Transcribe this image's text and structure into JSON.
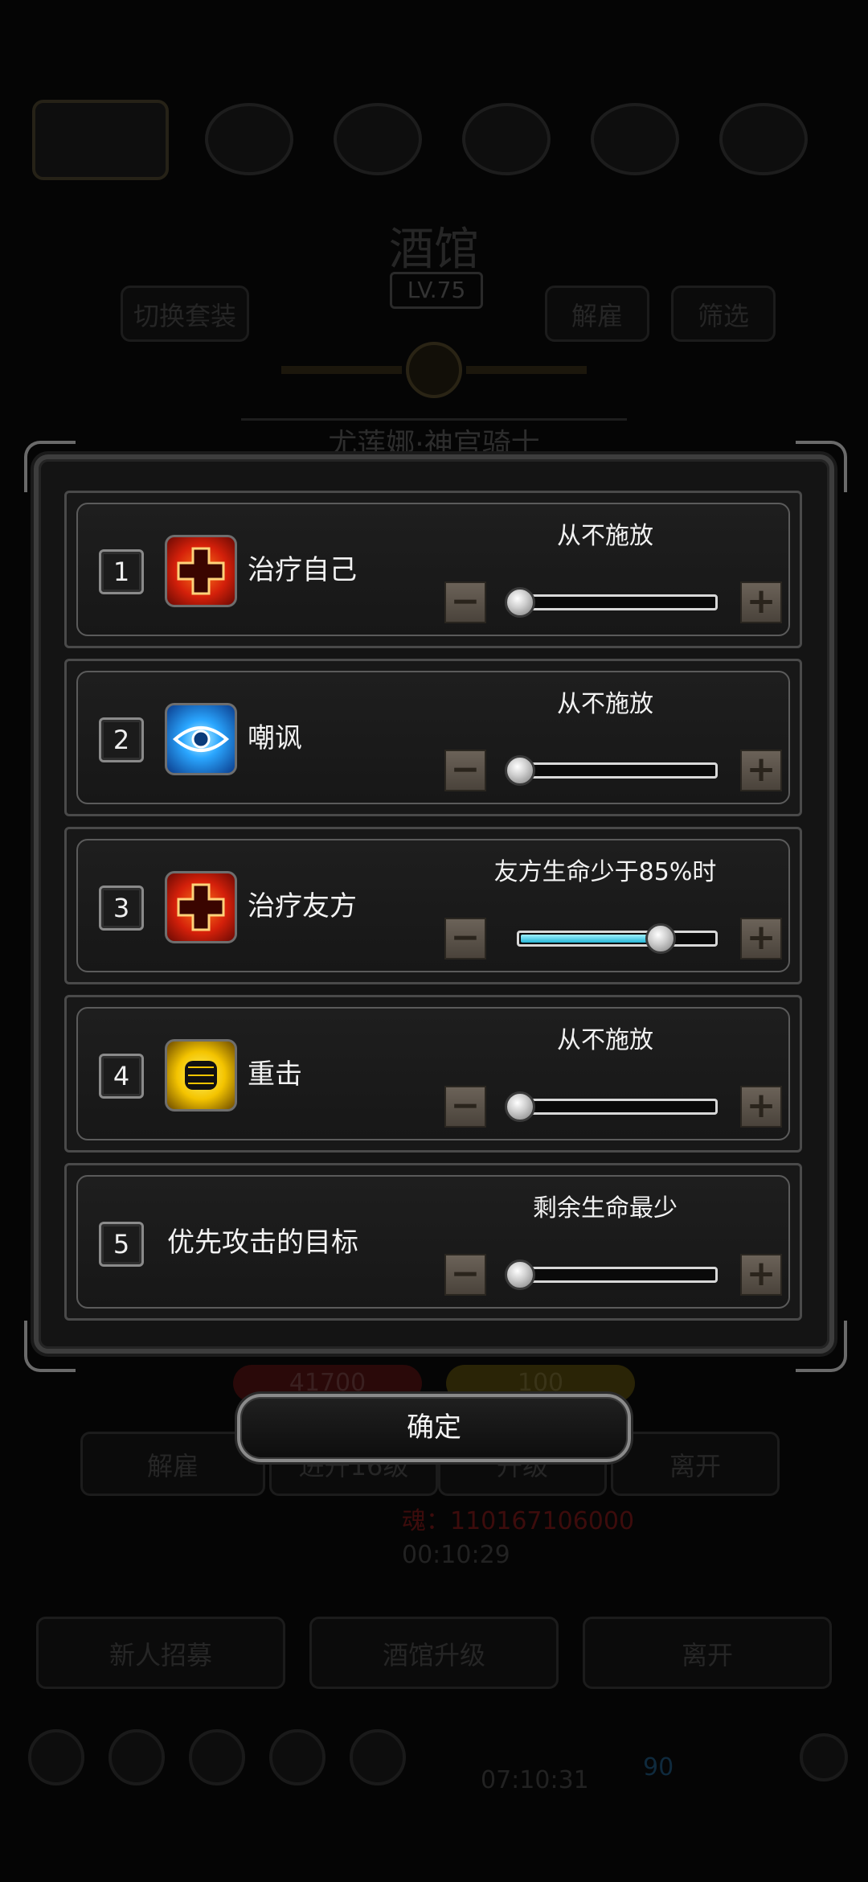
{
  "background": {
    "title": "酒馆",
    "level": "LV.75",
    "switch_equipment": "切换套装",
    "dismiss_top": "解雇",
    "filter": "筛选",
    "hero_name": "尤莲娜·神官骑士",
    "hp_value": "41700",
    "energy_value": "100",
    "btn_dismiss": "解雇",
    "btn_promote": "进升16级",
    "btn_upgrade": "升级",
    "btn_leave": "离开",
    "soul_text": "魂：110167106000",
    "timer": "00:10:29",
    "recruit": "新人招募",
    "tavern_upgrade": "酒馆升级",
    "leave_bottom": "离开",
    "clock": "07:10:31",
    "gem_count": "90"
  },
  "rows": [
    {
      "number": "1",
      "icon": "heal-cross-icon",
      "label": "治疗自己",
      "setting": "从不施放",
      "level": 0.0
    },
    {
      "number": "2",
      "icon": "taunt-eye-icon",
      "label": "嘲讽",
      "setting": "从不施放",
      "level": 0.0
    },
    {
      "number": "3",
      "icon": "heal-cross-icon",
      "label": "治疗友方",
      "setting": "友方生命少于85%时",
      "level": 0.85
    },
    {
      "number": "4",
      "icon": "fist-strike-icon",
      "label": "重击",
      "setting": "从不施放",
      "level": 0.0
    },
    {
      "number": "5",
      "icon": "",
      "label": "优先攻击的目标",
      "setting": "剩余生命最少",
      "level": 0.0
    }
  ],
  "controls": {
    "minus": "−",
    "plus": "+"
  },
  "confirm_label": "确定",
  "colors": {
    "slider_fill": "#27b6d6",
    "panel_border": "#3d3d3d"
  }
}
